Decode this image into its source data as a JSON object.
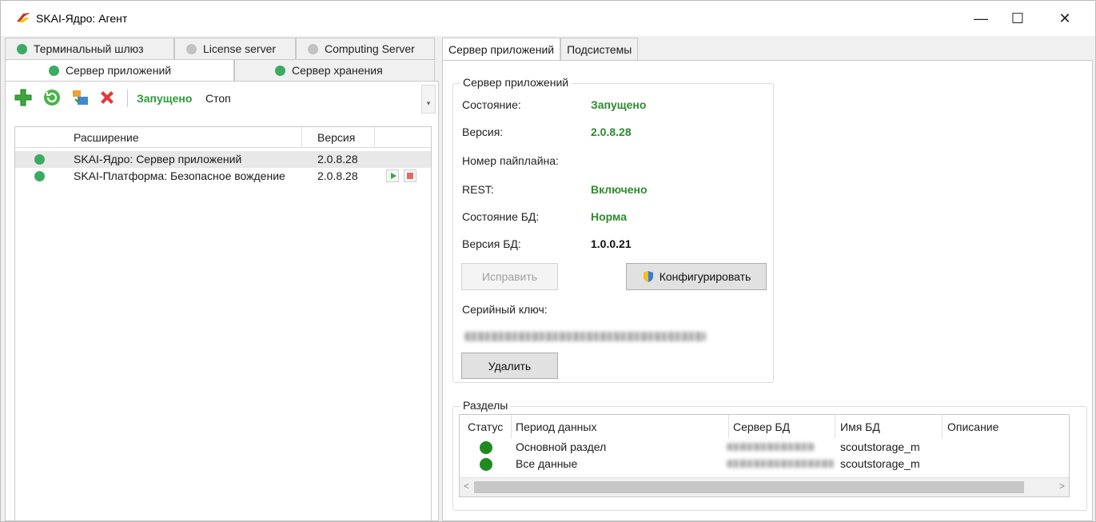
{
  "window": {
    "title": "SKAI-Ядро: Агент",
    "minimize_glyph": "—",
    "maximize_glyph": "☐",
    "close_glyph": "✕"
  },
  "left_tabs": {
    "row1": [
      {
        "label": "Терминальный шлюз",
        "status": "green"
      },
      {
        "label": "License server",
        "status": "gray"
      },
      {
        "label": "Computing Server",
        "status": "gray"
      }
    ],
    "row2": [
      {
        "label": "Сервер приложений",
        "status": "green",
        "active": true
      },
      {
        "label": "Сервер хранения",
        "status": "green"
      }
    ]
  },
  "toolbar": {
    "status_label": "Запущено",
    "stop_label": "Стоп",
    "overflow_glyph": "▾",
    "icons": [
      "add-icon",
      "refresh-icon",
      "update-icon",
      "delete-icon"
    ]
  },
  "extensions": {
    "columns": [
      "Расширение",
      "Версия"
    ],
    "rows": [
      {
        "name": "SKAI-Ядро: Сервер приложений",
        "version": "2.0.8.28",
        "status": "green"
      },
      {
        "name": "SKAI-Платформа: Безопасное вождение",
        "version": "2.0.8.28",
        "status": "green"
      }
    ]
  },
  "right_tabs": [
    {
      "label": "Сервер приложений",
      "active": true
    },
    {
      "label": "Подсистемы",
      "active": false
    }
  ],
  "app_server": {
    "group_title": "Сервер приложений",
    "fields": [
      {
        "label": "Состояние:",
        "value": "Запущено",
        "color": "#2e8b2e"
      },
      {
        "label": "Версия:",
        "value": "2.0.8.28",
        "color": "#2e8b2e"
      },
      {
        "label": "Номер пайплайна:",
        "value": "",
        "color": "#111111"
      },
      {
        "label": "REST:",
        "value": "Включено",
        "color": "#2e8b2e"
      },
      {
        "label": "Состояние БД:",
        "value": "Норма",
        "color": "#2e8b2e"
      },
      {
        "label": "Версия БД:",
        "value": "1.0.0.21",
        "color": "#111111"
      }
    ],
    "fix_button": "Исправить",
    "configure_button": "Конфигурировать",
    "serial_label": "Серийный ключ:",
    "delete_button": "Удалить"
  },
  "partitions": {
    "group_title": "Разделы",
    "columns": [
      "Статус",
      "Период данных",
      "Сервер БД",
      "Имя БД",
      "Описание"
    ],
    "rows": [
      {
        "period": "Основной раздел",
        "db_name": "scoutstorage_m",
        "description": ""
      },
      {
        "period": "Все данные",
        "db_name": "scoutstorage_m",
        "description": ""
      }
    ],
    "scroll_left": "<",
    "scroll_right": ">"
  }
}
